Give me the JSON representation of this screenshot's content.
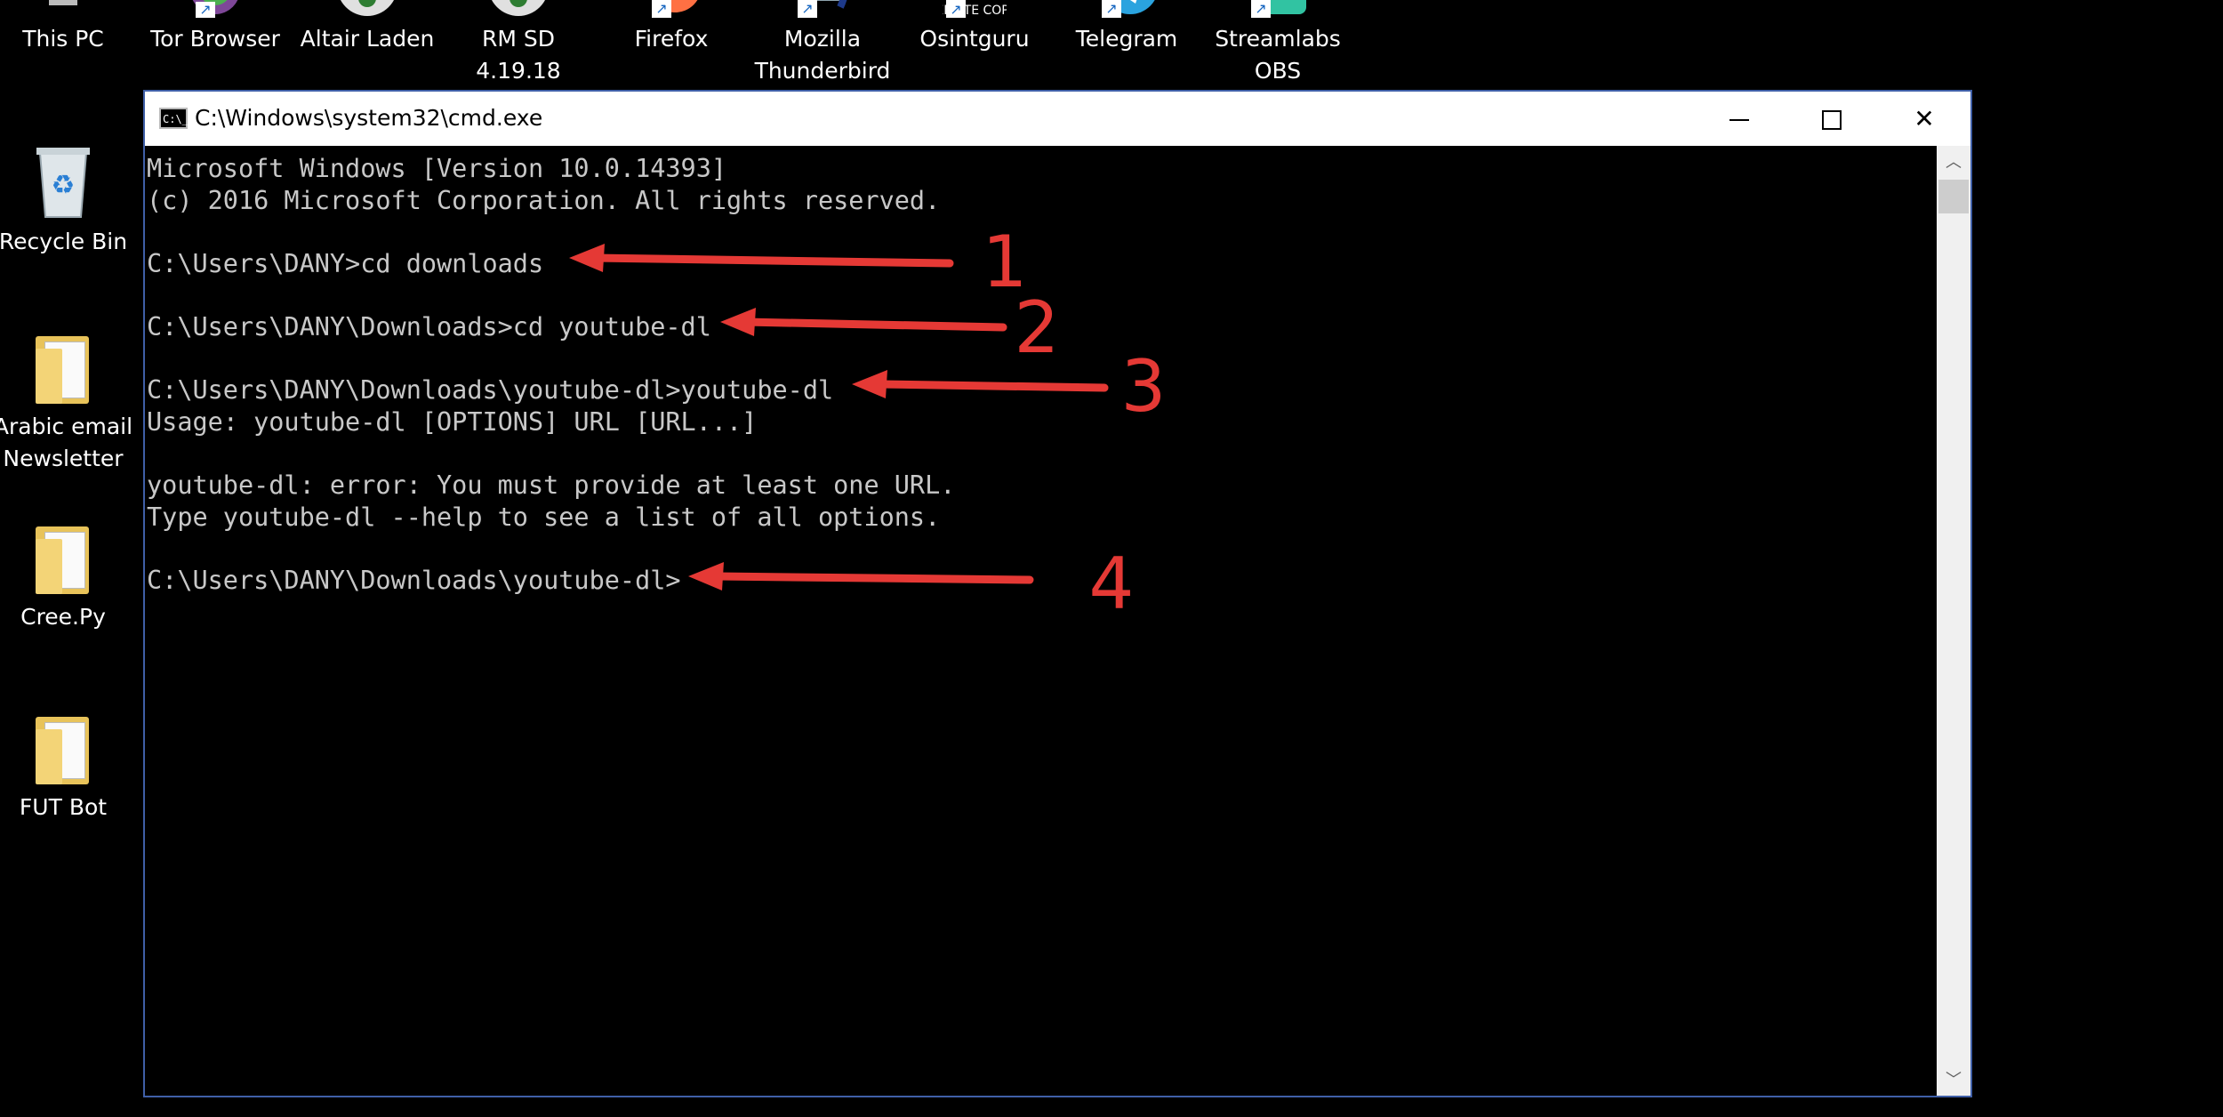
{
  "desktop": {
    "top_icons": [
      {
        "label": "This PC",
        "icon": "this-pc-icon"
      },
      {
        "label": "Tor Browser",
        "icon": "tor-browser-icon"
      },
      {
        "label": "Altair Laden",
        "icon": "altair-laden-icon"
      },
      {
        "label": "RM SD\n4.19.18",
        "icon": "rm-sd-icon"
      },
      {
        "label": "Firefox",
        "icon": "firefox-icon"
      },
      {
        "label": "Mozilla\nThunderbird",
        "icon": "thunderbird-icon"
      },
      {
        "label": "Osintguru",
        "icon": "osintguru-icon",
        "badge_text": "WEBSITE COPIER"
      },
      {
        "label": "Telegram",
        "icon": "telegram-icon"
      },
      {
        "label": "Streamlabs\nOBS",
        "icon": "streamlabs-obs-icon"
      }
    ],
    "left_icons": [
      {
        "label": "Recycle Bin",
        "icon": "recycle-bin-icon"
      },
      {
        "label": "Arabic email\nNewsletter",
        "icon": "folder-icon"
      },
      {
        "label": "Cree.Py",
        "icon": "folder-icon"
      },
      {
        "label": "FUT Bot",
        "icon": "folder-icon"
      }
    ]
  },
  "window": {
    "title": "C:\\Windows\\system32\\cmd.exe",
    "app_icon_text": "C:\\_",
    "border_color": "#3f5fa7"
  },
  "console": {
    "text_color": "#c8c8c8",
    "lines": [
      "Microsoft Windows [Version 10.0.14393]",
      "(c) 2016 Microsoft Corporation. All rights reserved.",
      "",
      "C:\\Users\\DANY>cd downloads",
      "",
      "C:\\Users\\DANY\\Downloads>cd youtube-dl",
      "",
      "C:\\Users\\DANY\\Downloads\\youtube-dl>youtube-dl",
      "Usage: youtube-dl [OPTIONS] URL [URL...]",
      "",
      "youtube-dl: error: You must provide at least one URL.",
      "Type youtube-dl --help to see a list of all options.",
      "",
      "C:\\Users\\DANY\\Downloads\\youtube-dl>"
    ]
  },
  "annotations": {
    "color": "#e53935",
    "labels": [
      "1",
      "2",
      "3",
      "4"
    ]
  }
}
